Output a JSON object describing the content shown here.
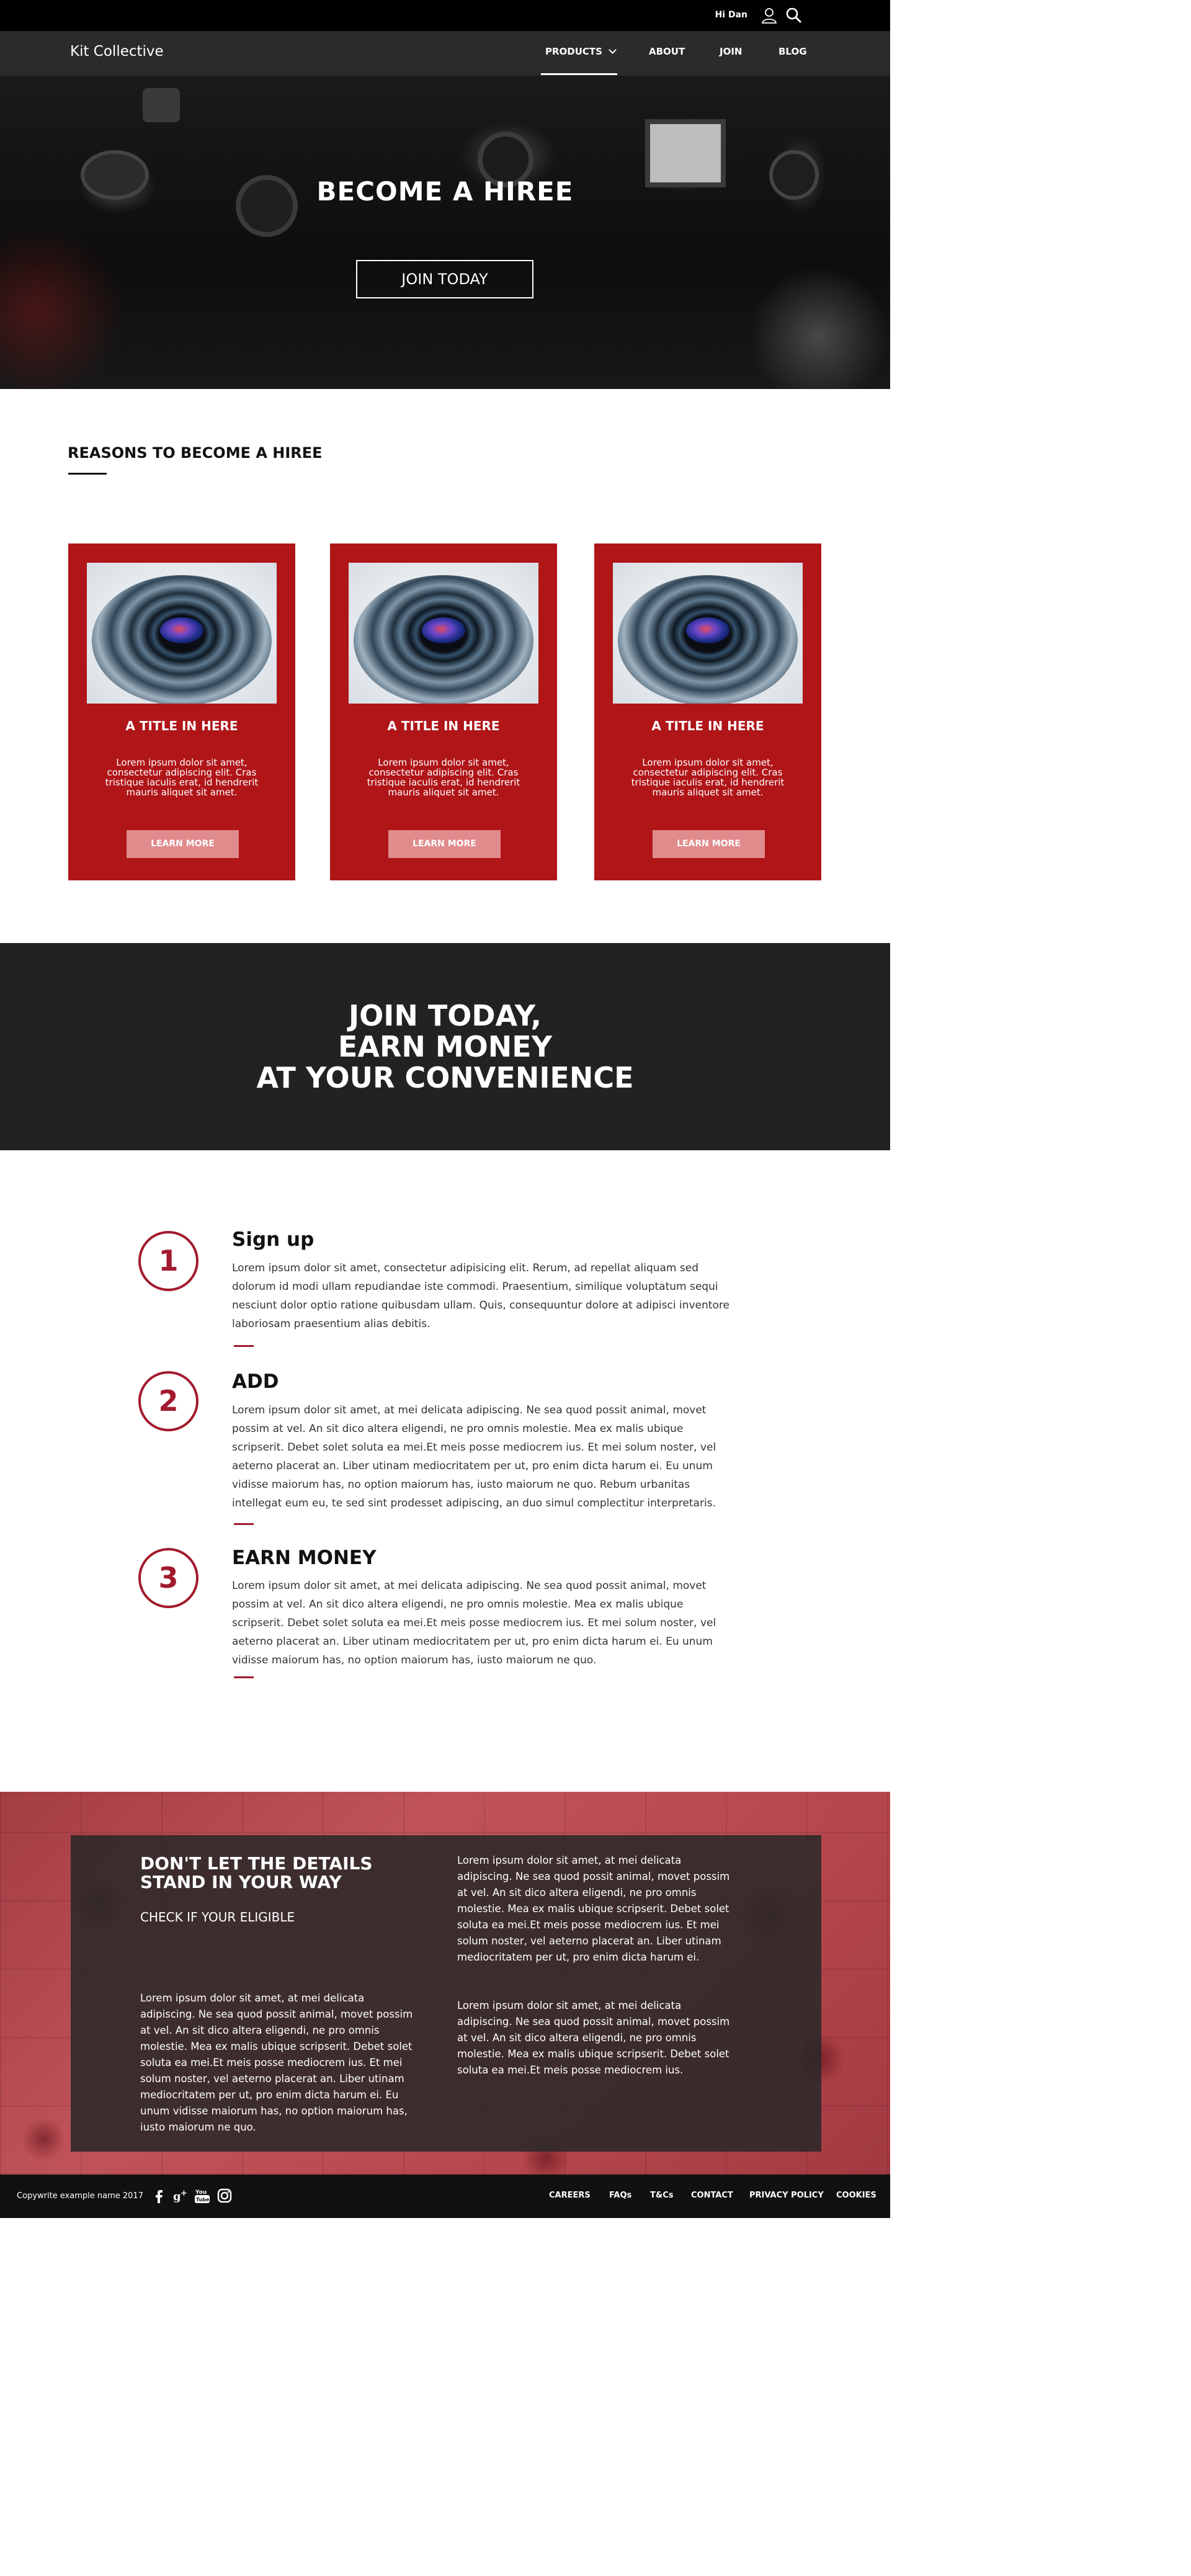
{
  "topbar": {
    "greeting": "Hi Dan"
  },
  "nav": {
    "brand": "Kit Collective",
    "items": [
      "PRODUCTS",
      "ABOUT",
      "JOIN",
      "BLOG"
    ]
  },
  "hero": {
    "title": "BECOME A HIREE",
    "button": "JOIN TODAY"
  },
  "reasons": {
    "heading": "REASONS TO BECOME A HIREE",
    "cards": [
      {
        "title": "A TITLE IN HERE",
        "text": "Lorem ipsum dolor sit amet, consectetur adipiscing elit. Cras tristique iaculis erat, id hendrerit mauris aliquet sit amet.",
        "button": "LEARN MORE"
      },
      {
        "title": "A TITLE IN HERE",
        "text": "Lorem ipsum dolor sit amet, consectetur adipiscing elit. Cras tristique iaculis erat, id hendrerit mauris aliquet sit amet.",
        "button": "LEARN MORE"
      },
      {
        "title": "A TITLE IN HERE",
        "text": "Lorem ipsum dolor sit amet, consectetur adipiscing elit. Cras tristique iaculis erat, id hendrerit mauris aliquet sit amet.",
        "button": "LEARN MORE"
      }
    ]
  },
  "banner": {
    "lines": [
      "JOIN TODAY,",
      "EARN MONEY",
      "AT YOUR CONVENIENCE"
    ]
  },
  "steps": [
    {
      "number": "1",
      "title": "Sign up",
      "body": "Lorem ipsum dolor sit amet, consectetur adipisicing elit. Rerum, ad repellat aliquam sed dolorum id modi ullam repudiandae iste commodi. Praesentium, similique voluptatum sequi nesciunt dolor optio ratione quibusdam ullam. Quis, consequuntur dolore at adipisci inventore laboriosam praesentium alias debitis."
    },
    {
      "number": "2",
      "title": "ADD",
      "body": "Lorem ipsum dolor sit amet, at mei delicata adipiscing. Ne sea quod possit animal, movet possim at vel. An sit dico altera eligendi, ne pro omnis molestie. Mea ex malis ubique scripserit. Debet solet soluta ea mei.Et meis posse mediocrem ius. Et mei solum noster, vel aeterno placerat an. Liber utinam mediocritatem per ut, pro enim dicta harum ei. Eu unum vidisse maiorum has, no option maiorum has, iusto maiorum ne quo. Rebum urbanitas intellegat eum eu, te sed sint prodesset adipiscing, an duo simul complectitur interpretaris."
    },
    {
      "number": "3",
      "title": "EARN MONEY",
      "body": "Lorem ipsum dolor sit amet, at mei delicata adipiscing. Ne sea quod possit animal, movet possim at vel. An sit dico altera eligendi, ne pro omnis molestie. Mea ex malis ubique scripserit. Debet solet soluta ea mei.Et meis posse mediocrem ius. Et mei solum noster, vel aeterno placerat an. Liber utinam mediocritatem per ut, pro enim dicta harum ei. Eu unum vidisse maiorum has, no option maiorum has, iusto maiorum ne quo."
    }
  ],
  "details": {
    "heading": "DON'T LET THE DETAILS STAND IN YOUR WAY",
    "subheading": "CHECK IF YOUR ELIGIBLE",
    "left_text": "Lorem ipsum dolor sit amet, at mei delicata adipiscing. Ne sea quod possit animal, movet possim at vel. An sit dico altera eligendi, ne pro omnis molestie. Mea ex malis ubique scripserit. Debet solet soluta ea mei.Et meis posse mediocrem ius. Et mei solum noster, vel aeterno placerat an. Liber utinam mediocritatem per ut, pro enim dicta harum ei. Eu unum vidisse maiorum has, no option maiorum has, iusto maiorum ne quo.",
    "right_text_1": "Lorem ipsum dolor sit amet, at mei delicata adipiscing. Ne sea quod possit animal, movet possim at vel. An sit dico altera eligendi, ne pro omnis molestie. Mea ex malis ubique scripserit. Debet solet soluta ea mei.Et meis posse mediocrem ius. Et mei solum noster, vel aeterno placerat an. Liber utinam mediocritatem per ut, pro enim dicta harum ei.",
    "right_text_2": "Lorem ipsum dolor sit amet, at mei delicata adipiscing. Ne sea quod possit animal, movet possim at vel. An sit dico altera eligendi, ne pro omnis molestie. Mea ex malis ubique scripserit. Debet solet soluta ea mei.Et meis posse mediocrem ius."
  },
  "footer": {
    "copyright": "Copywrite example name 2017",
    "social": [
      "facebook-icon",
      "google-plus-icon",
      "youtube-icon",
      "instagram-icon"
    ],
    "links": [
      "CAREERS",
      "FAQs",
      "T&Cs",
      "CONTACT",
      "PRIVACY POLICY",
      "COOKIES"
    ]
  },
  "colors": {
    "accent": "#b01518",
    "dark": "#222222",
    "button_light": "#e08b8c"
  }
}
